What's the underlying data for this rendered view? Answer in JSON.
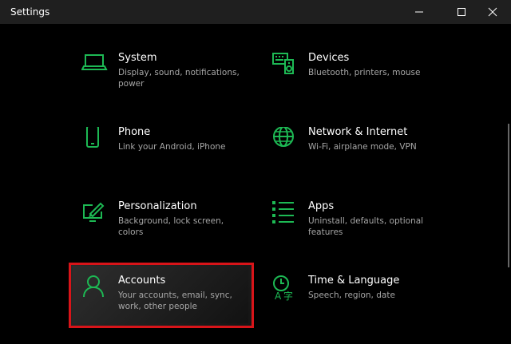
{
  "window": {
    "title": "Settings",
    "minimize_icon": "minimize-icon",
    "maximize_icon": "maximize-icon",
    "close_icon": "close-icon"
  },
  "colors": {
    "accent": "#1db954",
    "highlight_border": "#d81419",
    "description": "#a6a6a6"
  },
  "tiles": [
    {
      "name": "System",
      "description": "Display, sound, notifications, power",
      "icon": "laptop-icon"
    },
    {
      "name": "Devices",
      "description": "Bluetooth, printers, mouse",
      "icon": "keyboard-speaker-icon"
    },
    {
      "name": "Phone",
      "description": "Link your Android, iPhone",
      "icon": "phone-icon"
    },
    {
      "name": "Network & Internet",
      "description": "Wi-Fi, airplane mode, VPN",
      "icon": "globe-icon"
    },
    {
      "name": "Personalization",
      "description": "Background, lock screen, colors",
      "icon": "paint-monitor-icon"
    },
    {
      "name": "Apps",
      "description": "Uninstall, defaults, optional features",
      "icon": "apps-list-icon"
    },
    {
      "name": "Accounts",
      "description": "Your accounts, email, sync, work, other people",
      "icon": "person-icon"
    },
    {
      "name": "Time & Language",
      "description": "Speech, region, date",
      "icon": "time-language-icon"
    }
  ]
}
